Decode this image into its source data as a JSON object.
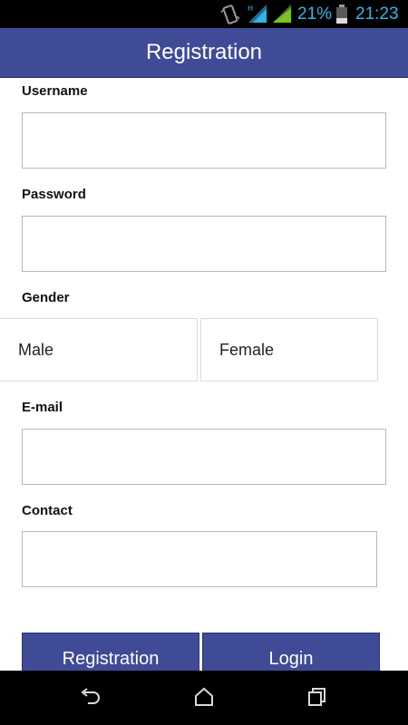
{
  "status_bar": {
    "network_type": "H",
    "battery_percent": "21%",
    "time": "21:23",
    "accent_color": "#33b5e5"
  },
  "header": {
    "title": "Registration",
    "color": "#3f4b97"
  },
  "form": {
    "username_label": "Username",
    "username_value": "",
    "password_label": "Password",
    "password_value": "",
    "gender_label": "Gender",
    "gender_options": [
      "Male",
      "Female"
    ],
    "email_label": "E-mail",
    "email_value": "",
    "contact_label": "Contact",
    "contact_value": ""
  },
  "actions": {
    "register_label": "Registration",
    "login_label": "Login"
  },
  "nav": {
    "icons": [
      "back-icon",
      "home-icon",
      "recent-apps-icon"
    ]
  }
}
